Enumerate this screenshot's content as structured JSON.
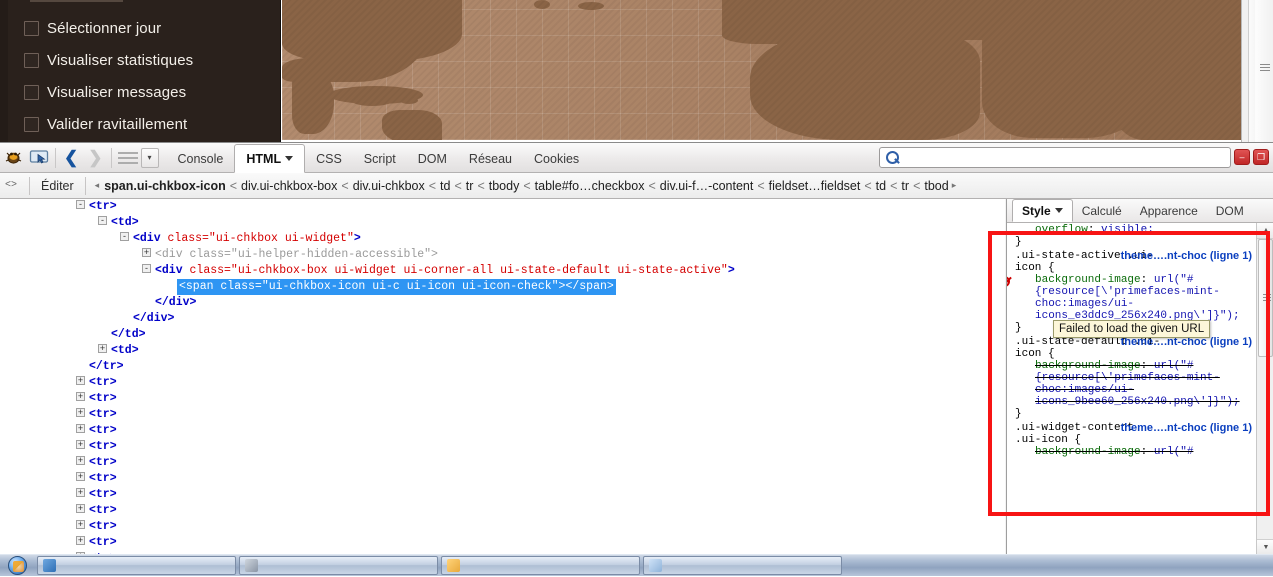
{
  "webpage": {
    "checkboxes": [
      {
        "label": "Sélectionner jour",
        "checked": false
      },
      {
        "label": "Visualiser statistiques",
        "checked": false
      },
      {
        "label": "Visualiser messages",
        "checked": false
      },
      {
        "label": "Valider ravitaillement",
        "checked": false
      }
    ]
  },
  "firebug": {
    "toolbar": {
      "icons": [
        "firebug-bug-icon",
        "inspect-element-icon"
      ],
      "nav_back": "❮",
      "nav_forward": "❯",
      "tabs": [
        {
          "label": "Console",
          "selected": false,
          "has_caret": false
        },
        {
          "label": "HTML",
          "selected": true,
          "has_caret": true
        },
        {
          "label": "CSS",
          "selected": false,
          "has_caret": false
        },
        {
          "label": "Script",
          "selected": false,
          "has_caret": false
        },
        {
          "label": "DOM",
          "selected": false,
          "has_caret": false
        },
        {
          "label": "Réseau",
          "selected": false,
          "has_caret": false
        },
        {
          "label": "Cookies",
          "selected": false,
          "has_caret": false
        }
      ],
      "search_value": "",
      "search_placeholder": "",
      "minimize_label": "–",
      "maximize_label": "❐"
    },
    "breadcrumb": {
      "edit_label": "Éditer",
      "prev_arrow": "◂",
      "next_arrow": "▸",
      "separator": "<",
      "items": [
        {
          "label": "span.ui-chkbox-icon",
          "current": true
        },
        {
          "label": "div.ui-chkbox-box",
          "current": false
        },
        {
          "label": "div.ui-chkbox",
          "current": false
        },
        {
          "label": "td",
          "current": false
        },
        {
          "label": "tr",
          "current": false
        },
        {
          "label": "tbody",
          "current": false
        },
        {
          "label": "table#fo…checkbox",
          "current": false
        },
        {
          "label": "div.ui-f…-content",
          "current": false
        },
        {
          "label": "fieldset…fieldset",
          "current": false
        },
        {
          "label": "td",
          "current": false
        },
        {
          "label": "tr",
          "current": false
        },
        {
          "label": "tbod",
          "current": false
        }
      ]
    },
    "html_panel": {
      "lines": [
        {
          "indent": 3,
          "twisty": "-",
          "html": "<span class='tag'>&lt;tr&gt;</span>"
        },
        {
          "indent": 4,
          "twisty": "-",
          "html": "<span class='tag'>&lt;td&gt;</span>"
        },
        {
          "indent": 5,
          "twisty": "-",
          "html": "<span class='tag'>&lt;div </span><span class='attr'>class=\"ui-chkbox ui-widget\"</span><span class='tag'>&gt;</span>"
        },
        {
          "indent": 6,
          "twisty": "+",
          "html": "<span class='tagdim'>&lt;div class=\"ui-helper-hidden-accessible\"&gt;</span>"
        },
        {
          "indent": 6,
          "twisty": "-",
          "html": "<span class='tag'>&lt;div </span><span class='attr'>class=\"ui-chkbox-box ui-widget ui-corner-all ui-state-default ui-state-active\"</span><span class='tag'>&gt;</span>"
        },
        {
          "indent": 7,
          "twisty": "",
          "selected": true,
          "html": "&lt;span class=\"ui-chkbox-icon ui-c ui-icon ui-icon-check\"&gt;&lt;/span&gt;"
        },
        {
          "indent": 6,
          "twisty": "",
          "html": "<span class='tag'>&lt;/div&gt;</span>"
        },
        {
          "indent": 5,
          "twisty": "",
          "html": "<span class='tag'>&lt;/div&gt;</span>"
        },
        {
          "indent": 4,
          "twisty": "",
          "html": "<span class='tag'>&lt;/td&gt;</span>"
        },
        {
          "indent": 4,
          "twisty": "+",
          "html": "<span class='tag'>&lt;td&gt;</span>"
        },
        {
          "indent": 3,
          "twisty": "",
          "html": "<span class='tag'>&lt;/tr&gt;</span>"
        },
        {
          "indent": 3,
          "twisty": "+",
          "html": "<span class='tag'>&lt;tr&gt;</span>"
        },
        {
          "indent": 3,
          "twisty": "+",
          "html": "<span class='tag'>&lt;tr&gt;</span>"
        },
        {
          "indent": 3,
          "twisty": "+",
          "html": "<span class='tag'>&lt;tr&gt;</span>"
        },
        {
          "indent": 3,
          "twisty": "+",
          "html": "<span class='tag'>&lt;tr&gt;</span>"
        },
        {
          "indent": 3,
          "twisty": "+",
          "html": "<span class='tag'>&lt;tr&gt;</span>"
        },
        {
          "indent": 3,
          "twisty": "+",
          "html": "<span class='tag'>&lt;tr&gt;</span>"
        },
        {
          "indent": 3,
          "twisty": "+",
          "html": "<span class='tag'>&lt;tr&gt;</span>"
        },
        {
          "indent": 3,
          "twisty": "+",
          "html": "<span class='tag'>&lt;tr&gt;</span>"
        },
        {
          "indent": 3,
          "twisty": "+",
          "html": "<span class='tag'>&lt;tr&gt;</span>"
        },
        {
          "indent": 3,
          "twisty": "+",
          "html": "<span class='tag'>&lt;tr&gt;</span>"
        },
        {
          "indent": 3,
          "twisty": "+",
          "html": "<span class='tag'>&lt;tr&gt;</span>"
        },
        {
          "indent": 3,
          "twisty": "+",
          "html": "<span class='tag'>&lt;tr&gt;</span>"
        }
      ]
    },
    "side_panel": {
      "tabs": [
        {
          "label": "Style",
          "selected": true,
          "has_caret": true
        },
        {
          "label": "Calculé",
          "selected": false,
          "has_caret": false
        },
        {
          "label": "Apparence",
          "selected": false,
          "has_caret": false
        },
        {
          "label": "DOM",
          "selected": false,
          "has_caret": false
        }
      ],
      "partial_top": {
        "prop": "overflow",
        "value": "visible;",
        "close": "}"
      },
      "rules": [
        {
          "selector": ".ui-state-active .ui-icon {",
          "source": "theme….nt-choc (ligne 1)",
          "has_error": true,
          "struck": false,
          "prop": "background-image",
          "value": "url(\"#{resource[\\'primefaces-mint-choc:images/ui-icons_e3ddc9_256x240.png\\']}\");",
          "close": "}"
        },
        {
          "selector": ".ui-state-default .ui-icon {",
          "source": "theme….nt-choc (ligne 1)",
          "has_error": false,
          "struck": true,
          "prop": "background-image",
          "value": "url(\"#{resource[\\'primefaces-mint-choc:images/ui-icons_9bee60_256x240.png\\']}\");",
          "close": "}"
        },
        {
          "selector": ".ui-widget-content .ui-icon {",
          "source": "theme….nt-choc (ligne 1)",
          "has_error": false,
          "struck": true,
          "prop": "background-image",
          "value": "url(\"#",
          "close": ""
        }
      ],
      "tooltip": "Failed to load the given URL"
    },
    "annotation_color": "#f71414"
  },
  "taskbar": {
    "start_label": "start-orb",
    "buttons": [
      {
        "label": "",
        "color": "#2f6fb5"
      },
      {
        "label": "",
        "color": "#9aa7b8"
      },
      {
        "label": "",
        "color": "#e8a93c"
      },
      {
        "label": "",
        "color": "#8fb3d9"
      }
    ]
  }
}
